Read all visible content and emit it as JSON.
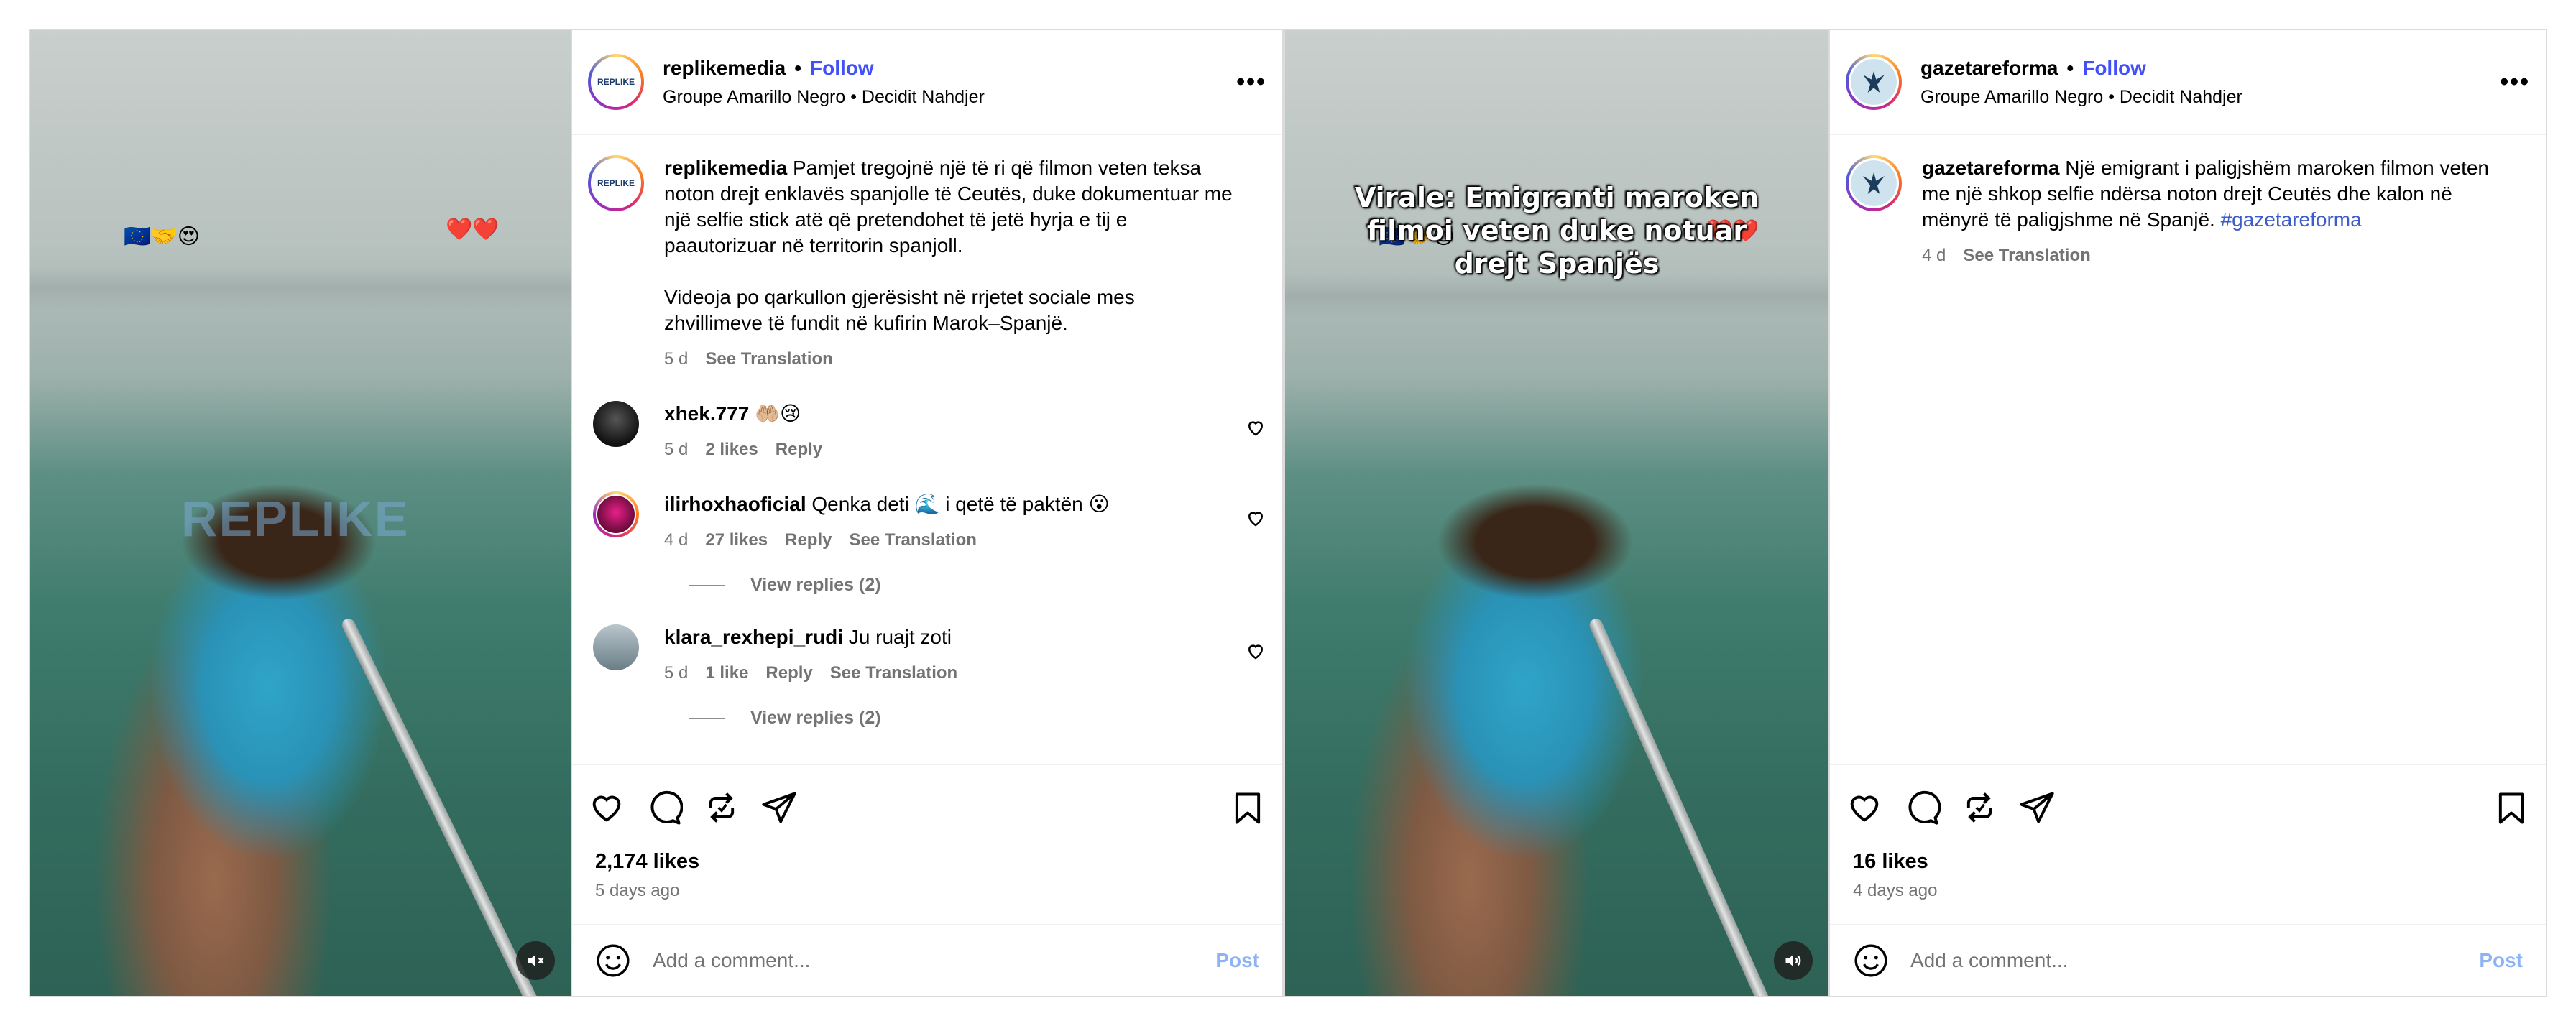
{
  "post1": {
    "username": "replikemedia",
    "follow_label": "Follow",
    "separator": "•",
    "audio_line": "Groupe Amarillo Negro  •  Decidit Nahdjer",
    "avatar_text": "REPLIKE",
    "watermark": "REPLIKE",
    "overlay_emojis_left": "🇪🇺🤝😍",
    "overlay_emojis_right": "❤️❤️",
    "caption": {
      "text": "Pamjet tregojnë një të ri që filmon veten teksa noton drejt enklavës spanjolle të Ceutës, duke dokumentuar me një selfie stick atë që pretendohet të jetë hyrja e tij e paautorizuar në territorin spanjoll.",
      "text2": "Videoja po qarkullon gjerësisht në rrjetet sociale mes zhvillimeve të fundit në kufirin Marok–Spanjë.",
      "time": "5 d",
      "translate": "See Translation"
    },
    "comments": [
      {
        "user": "xhek.777",
        "text": "🤲🏼😢",
        "time": "5 d",
        "likes": "2 likes",
        "reply": "Reply"
      },
      {
        "user": "ilirhoxhaoficial",
        "text": "Qenka deti 🌊 i qetë të paktën 😮",
        "time": "4 d",
        "likes": "27 likes",
        "reply": "Reply",
        "translate": "See Translation",
        "view_replies": "View replies (2)"
      },
      {
        "user": "klara_rexhepi_rudi",
        "text": "Ju ruajt zoti",
        "time": "5 d",
        "likes": "1 like",
        "reply": "Reply",
        "translate": "See Translation",
        "view_replies": "View replies (2)"
      }
    ],
    "likes": "2,174 likes",
    "ago": "5 days ago",
    "add_comment_placeholder": "Add a comment...",
    "post_label": "Post",
    "icons": [
      "heart-icon",
      "comment-icon",
      "repost-icon",
      "share-icon",
      "bookmark-icon",
      "emoji-icon",
      "muted-icon"
    ]
  },
  "post2": {
    "username": "gazetareforma",
    "follow_label": "Follow",
    "separator": "•",
    "audio_line": "Groupe Amarillo Negro  •  Decidit Nahdjer",
    "overlay_title": "Virale: Emigranti maroken filmoi veten duke notuar drejt Spanjës",
    "overlay_emojis_left": "🇪🇺🤝😍",
    "overlay_emojis_right": "❤️❤️",
    "caption": {
      "text": "Një emigrant i paligjshëm maroken filmon veten me një shkop selfie ndërsa noton drejt Ceutës dhe kalon në mënyrë të paligjshme në Spanjë.",
      "hashtag": "#gazetareforma",
      "time": "4 d",
      "translate": "See Translation"
    },
    "likes": "16 likes",
    "ago": "4 days ago",
    "add_comment_placeholder": "Add a comment...",
    "post_label": "Post",
    "icons": [
      "heart-icon",
      "comment-icon",
      "repost-icon",
      "share-icon",
      "bookmark-icon",
      "emoji-icon",
      "sound-icon"
    ]
  },
  "colors": {
    "follow": "#4150f7",
    "post_button": "#8cb4f5",
    "muted_text": "#737373",
    "border": "#dbdbdb"
  }
}
